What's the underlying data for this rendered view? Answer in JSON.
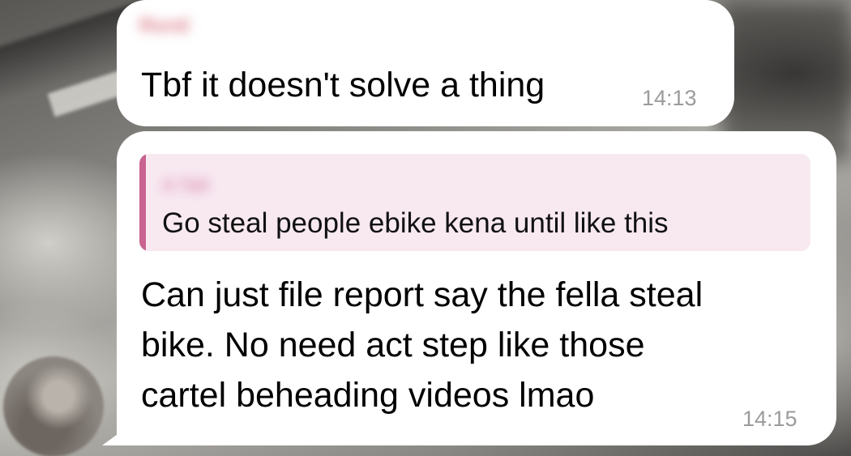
{
  "chat": {
    "messages": [
      {
        "sender_name": "Rural",
        "text": "Tbf it doesn't solve a thing",
        "time": "14:13"
      },
      {
        "reply_to": {
          "author": "A Tall",
          "text": "Go steal people ebike kena until like this"
        },
        "text_lines": [
          "Can just file report say the fella steal",
          "bike. No need act step like those",
          "cartel beheading videos lmao"
        ],
        "time": "14:15"
      }
    ]
  },
  "colors": {
    "bubble": "#ffffff",
    "sender_name": "#d97a86",
    "reply_background": "#f8e9f1",
    "reply_bar": "#c9638f",
    "timestamp": "#9b9b9b"
  },
  "icons": {
    "avatar": "contact-avatar"
  }
}
